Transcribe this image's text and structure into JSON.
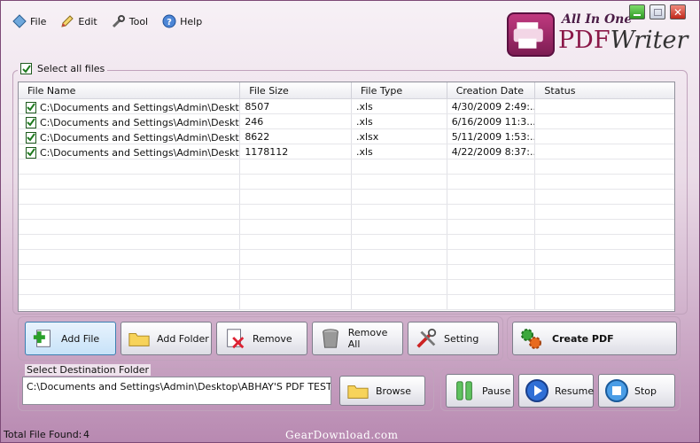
{
  "menu": [
    {
      "label": "File",
      "icon": "file-diamond-icon"
    },
    {
      "label": "Edit",
      "icon": "edit-pen-icon"
    },
    {
      "label": "Tool",
      "icon": "tool-icon"
    },
    {
      "label": "Help",
      "icon": "help-icon"
    }
  ],
  "logo": {
    "top": "All In One",
    "main_a": "PDF",
    "main_b": "Writer"
  },
  "window_controls": {
    "close_glyph": "✕"
  },
  "select_all": {
    "label": "Select all files",
    "checked": true
  },
  "table": {
    "columns": [
      "File Name",
      "File Size",
      "File Type",
      "Creation Date",
      "Status"
    ],
    "rows": [
      {
        "checked": true,
        "name": "C:\\Documents and Settings\\Admin\\Desktop...",
        "size": "8507",
        "type": ".xls",
        "date": "4/30/2009 2:49:...",
        "status": ""
      },
      {
        "checked": true,
        "name": "C:\\Documents and Settings\\Admin\\Desktop...",
        "size": "246",
        "type": ".xls",
        "date": "6/16/2009 11:3...",
        "status": ""
      },
      {
        "checked": true,
        "name": "C:\\Documents and Settings\\Admin\\Desktop...",
        "size": "8622",
        "type": ".xlsx",
        "date": "5/11/2009 1:53:...",
        "status": ""
      },
      {
        "checked": true,
        "name": "C:\\Documents and Settings\\Admin\\Desktop...",
        "size": "1178112",
        "type": ".xls",
        "date": "4/22/2009 8:37:...",
        "status": ""
      }
    ],
    "empty_rows": 10
  },
  "actions": {
    "add_file": "Add File",
    "add_folder": "Add Folder",
    "remove": "Remove",
    "remove_all": "Remove All",
    "setting": "Setting",
    "create_pdf": "Create PDF"
  },
  "destination": {
    "label": "Select Destination Folder",
    "value": "C:\\Documents and Settings\\Admin\\Desktop\\ABHAY'S PDF TESTING",
    "browse": "Browse"
  },
  "controls": {
    "pause": "Pause",
    "resume": "Resume",
    "stop": "Stop"
  },
  "status": {
    "label": "Total File Found:",
    "count": "4"
  },
  "watermark": "GearDownload.com",
  "colors": {
    "accent": "#8a1848",
    "frame": "#b889b1",
    "check": "#1e7a1e"
  }
}
